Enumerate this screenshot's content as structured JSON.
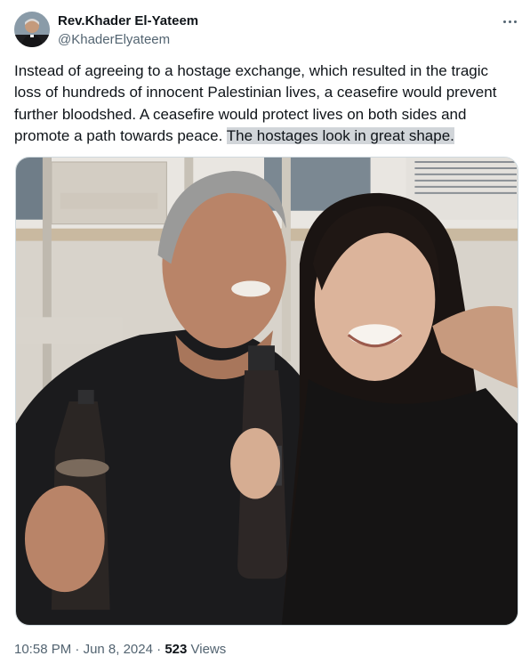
{
  "author": {
    "display_name": "Rev.Khader El-Yateem",
    "handle": "@KhaderElyateem",
    "avatar_icon": "profile-avatar"
  },
  "tweet": {
    "text_main": "Instead of agreeing to a hostage exchange, which resulted in the tragic loss of hundreds of innocent Palestinian lives, a ceasefire would prevent further bloodshed. A ceasefire would protect lives on both sides and promote a path towards peace. ",
    "text_highlighted": "The hostages look in great shape."
  },
  "meta": {
    "time": "10:58 PM",
    "separator": "·",
    "date": "Jun 8, 2024",
    "views_count": "523",
    "views_label": "Views"
  },
  "icons": {
    "more": "more-horizontal-icon"
  },
  "colors": {
    "text_primary": "#0f1419",
    "text_secondary": "#536471",
    "highlight": "#d1d5d9"
  }
}
